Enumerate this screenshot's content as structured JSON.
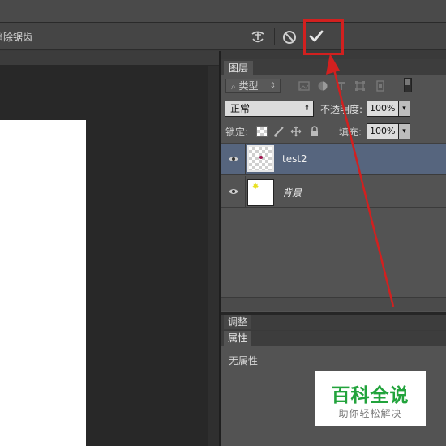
{
  "options_bar": {
    "antialias_label": "消除锯齿",
    "warp_icon": "warp-text-icon",
    "cancel_icon": "cancel-circle-icon",
    "commit_icon": "checkmark-icon"
  },
  "layers_panel": {
    "tab_label": "图层",
    "filter_type": "类型",
    "filter_icons": [
      "image-filter-icon",
      "adjustment-filter-icon",
      "text-filter-icon",
      "shape-filter-icon",
      "smart-object-filter-icon",
      "filter-toggle-icon"
    ],
    "blend_mode": "正常",
    "opacity_label": "不透明度:",
    "opacity_value": "100%",
    "lock_label": "锁定:",
    "lock_icons": [
      "lock-transparent-icon",
      "lock-brush-icon",
      "lock-move-icon",
      "lock-all-icon"
    ],
    "fill_label": "填充:",
    "fill_value": "100%",
    "layers": [
      {
        "name": "test2",
        "selected": true
      },
      {
        "name": "背景",
        "selected": false
      }
    ]
  },
  "adjustments_panel": {
    "tab_label": "调整"
  },
  "properties_panel": {
    "tab_label": "属性",
    "empty_text": "无属性"
  },
  "watermark": {
    "title": "百科全说",
    "subtitle": "助你轻松解决"
  },
  "colors": {
    "panel_bg": "#535353",
    "selected_layer": "#56657e",
    "highlight_red": "#d2201f",
    "watermark_green": "#22a33c"
  }
}
